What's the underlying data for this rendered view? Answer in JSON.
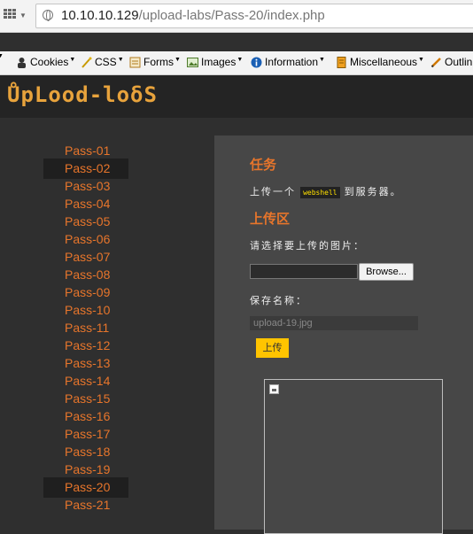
{
  "browser": {
    "url_host": "10.10.10.129",
    "url_path": "/upload-labs/Pass-20/index.php"
  },
  "toolbar": {
    "items": [
      {
        "label": "Cookies",
        "icon": "cookie-icon"
      },
      {
        "label": "CSS",
        "icon": "magic-wand-icon"
      },
      {
        "label": "Forms",
        "icon": "forms-icon"
      },
      {
        "label": "Images",
        "icon": "image-icon"
      },
      {
        "label": "Information",
        "icon": "info-icon"
      },
      {
        "label": "Miscellaneous",
        "icon": "misc-icon"
      },
      {
        "label": "Outlin",
        "icon": "pencil-icon"
      }
    ]
  },
  "header": {
    "logo_text": "ŮpLood-loδS"
  },
  "sidebar": {
    "items": [
      {
        "label": "Pass-01"
      },
      {
        "label": "Pass-02",
        "active": true
      },
      {
        "label": "Pass-03"
      },
      {
        "label": "Pass-04"
      },
      {
        "label": "Pass-05"
      },
      {
        "label": "Pass-06"
      },
      {
        "label": "Pass-07"
      },
      {
        "label": "Pass-08"
      },
      {
        "label": "Pass-09"
      },
      {
        "label": "Pass-10"
      },
      {
        "label": "Pass-11"
      },
      {
        "label": "Pass-12"
      },
      {
        "label": "Pass-13"
      },
      {
        "label": "Pass-14"
      },
      {
        "label": "Pass-15"
      },
      {
        "label": "Pass-16"
      },
      {
        "label": "Pass-17"
      },
      {
        "label": "Pass-18"
      },
      {
        "label": "Pass-19"
      },
      {
        "label": "Pass-20",
        "active": true
      },
      {
        "label": "Pass-21"
      }
    ]
  },
  "main": {
    "task_heading": "任务",
    "task_prefix": "上传一个",
    "task_code": "webshell",
    "task_suffix": "到服务器。",
    "upload_heading": "上传区",
    "select_label": "请选择要上传的图片：",
    "browse_label": "Browse...",
    "save_label": "保存名称：",
    "save_value": "upload-19.jpg",
    "upload_button": "上传"
  },
  "colors": {
    "accent": "#e7752b",
    "button": "#ffc400",
    "logo": "#e8a33c"
  }
}
